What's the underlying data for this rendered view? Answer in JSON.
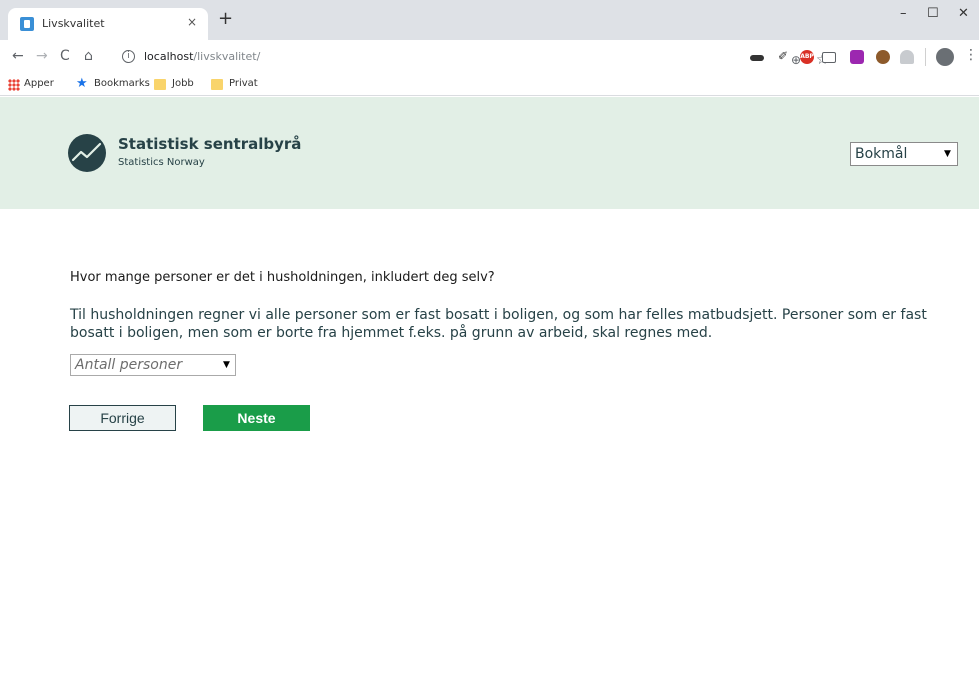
{
  "browser": {
    "tab_title": "Livskvalitet",
    "tab_close": "×",
    "new_tab": "+",
    "win_min": "–",
    "win_max": "☐",
    "win_close": "✕",
    "back": "←",
    "forward": "→",
    "reload": "C",
    "home": "⌂",
    "info": "i",
    "url_host": "localhost",
    "url_path": "/livskvalitet/",
    "zoom": "⊕",
    "star": "☆",
    "eyedropper": "✐",
    "abp": "ABP",
    "menu": "⋮"
  },
  "bookmarks": {
    "apps": "Apper",
    "star": "★",
    "bookmarks": "Bookmarks",
    "jobb": "Jobb",
    "privat": "Privat"
  },
  "header": {
    "logo_name": "Statistisk sentralbyrå",
    "logo_sub": "Statistics Norway",
    "language": "Bokmål"
  },
  "main": {
    "question": "Hvor mange personer er det i husholdningen, inkludert deg selv?",
    "help_text": "Til husholdningen regner vi alle personer som er fast bosatt i boligen, og som har felles matbudsjett. Personer som er fast bosatt i boligen, men som er borte fra hjemmet f.eks. på grunn av arbeid, skal regnes med.",
    "count_placeholder": "Antall personer",
    "dropdown_arrow": "▼",
    "prev_label": "Forrige",
    "next_label": "Neste"
  },
  "colors": {
    "header_bg": "#e2efe6",
    "brand_dark": "#274247",
    "next_green": "#1a9d49"
  }
}
